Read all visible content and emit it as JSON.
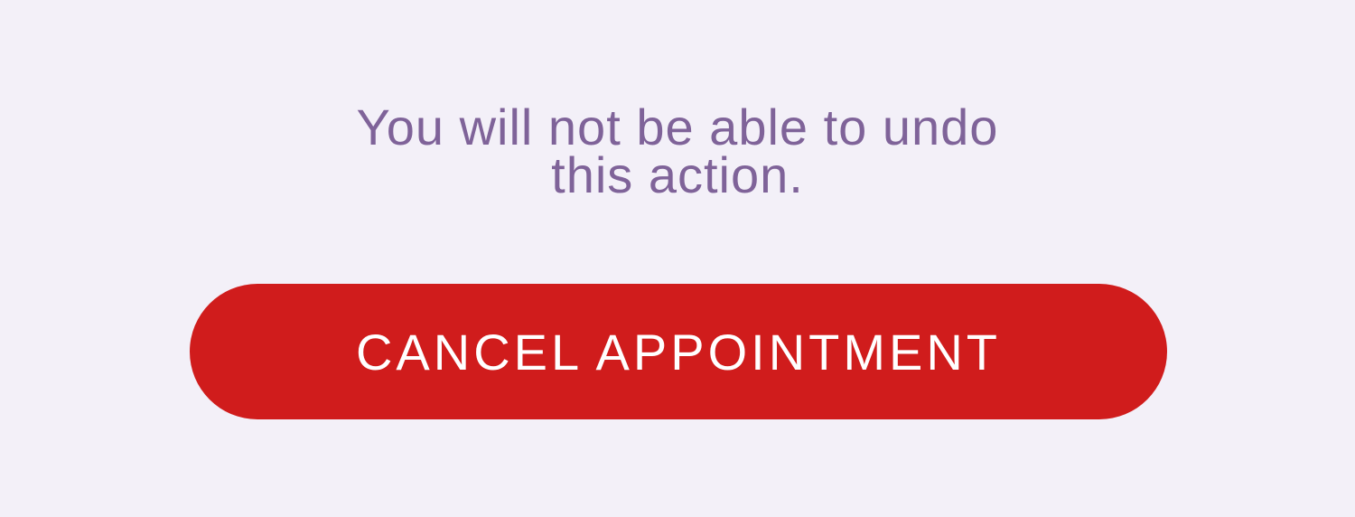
{
  "dialog": {
    "warning_line1": "You will not be able to undo",
    "warning_line2": "this action.",
    "cancel_label": "CANCEL APPOINTMENT"
  },
  "colors": {
    "background": "#f3f0f8",
    "warning_text": "#7f6399",
    "danger": "#d01c1c",
    "button_text": "#ffffff"
  }
}
